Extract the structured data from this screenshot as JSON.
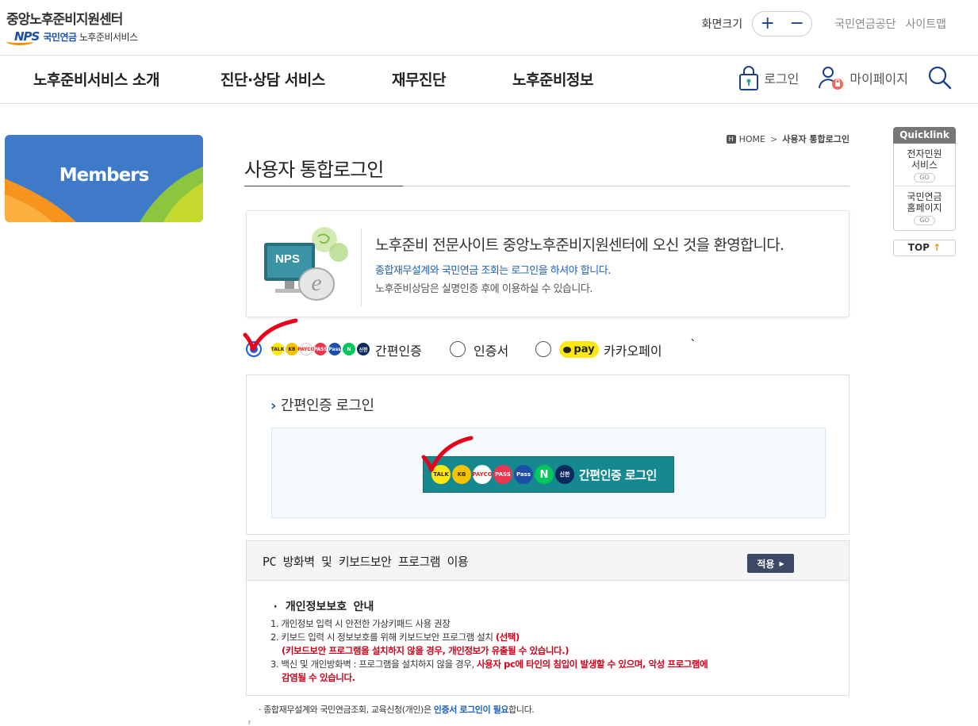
{
  "header": {
    "logo_title": "중앙노후준비지원센터",
    "logo_mark": "NPS",
    "logo_org": "국민연금",
    "logo_service": "노후준비서비스",
    "size_label": "화면크기",
    "size_plus": "+",
    "size_minus": "−",
    "links": [
      "국민연금공단",
      "사이트맵"
    ]
  },
  "gnb": {
    "items": [
      "노후준비서비스 소개",
      "진단·상담 서비스",
      "재무진단",
      "노후준비정보"
    ],
    "login": "로그인",
    "mypage": "마이페이지"
  },
  "side": {
    "banner": "Members"
  },
  "quick": {
    "head": "Quicklink",
    "items": [
      {
        "line1": "전자민원",
        "line2": "서비스",
        "go": "GO"
      },
      {
        "line1": "국민연금",
        "line2": "홈페이지",
        "go": "GO"
      }
    ],
    "top_label": "TOP",
    "top_arrow": "↑"
  },
  "breadcrumb": {
    "home_icon": "H",
    "home": "HOME",
    "sep": ">",
    "current": "사용자 통합로그인"
  },
  "page_title": "사용자 통합로그인",
  "welcome": {
    "title": "노후준비 전문사이트 중앙노후준비지원센터에 오신 것을 환영합니다.",
    "note1": "종합재무설계와 국민연금 조회는 로그인을 하셔야 합니다.",
    "note2": "노후준비상담은 실명인증 후에 이용하실 수 있습니다.",
    "illustration_label": "NPS"
  },
  "login_methods": {
    "selected": "simple",
    "options": [
      {
        "id": "simple",
        "label": "간편인증"
      },
      {
        "id": "cert",
        "label": "인증서"
      },
      {
        "id": "kakaopay",
        "label": "카카오페이",
        "pill": "pay"
      }
    ],
    "stray_mark": "`",
    "mini_badges": [
      {
        "name": "kakaotalk",
        "text": "TALK",
        "color": "#ffe812"
      },
      {
        "name": "kb",
        "text": "KB",
        "color": "#f5c400"
      },
      {
        "name": "payco",
        "text": "PAYCO",
        "color": "#ffffff"
      },
      {
        "name": "pass",
        "text": "PASS",
        "color": "#e8374f"
      },
      {
        "name": "samsung-pass",
        "text": "Pass",
        "color": "#1d4ea8"
      },
      {
        "name": "naver",
        "text": "N",
        "color": "#03c75a"
      },
      {
        "name": "shinhan",
        "text": "신한",
        "color": "#0a2a5e"
      }
    ]
  },
  "simple_login": {
    "title": "간편인증 로그인",
    "chevron": "›",
    "button_label": "간편인증 로그인",
    "badges": [
      {
        "name": "kakaotalk",
        "text": "TALK",
        "color": "#ffe812",
        "fg": "#3a1d1d"
      },
      {
        "name": "kb",
        "text": "KB",
        "color": "#f5c400",
        "fg": "#3a2a00"
      },
      {
        "name": "payco",
        "text": "PAYCO",
        "color": "#ffffff",
        "fg": "#e52528"
      },
      {
        "name": "pass",
        "text": "PASS",
        "color": "#e8374f",
        "fg": "#ffffff"
      },
      {
        "name": "samsung-pass",
        "text": "Pass",
        "color": "#1d4ea8",
        "fg": "#ffffff"
      },
      {
        "name": "naver",
        "text": "N",
        "color": "#03c75a",
        "fg": "#ffffff"
      },
      {
        "name": "shinhan",
        "text": "신한",
        "color": "#0a2a5e",
        "fg": "#ffffff"
      }
    ]
  },
  "security": {
    "title": "PC 방화벽 및 키보드보안 프로그램 이용",
    "apply": "적용",
    "apply_arrow": "▶",
    "privacy_title": "· 개인정보보호 안내",
    "items": {
      "i1": "1. 개인정보 입력 시 안전한 가상키패드 사용 권장",
      "i2": "2. 키보드 입력 시 정보보호를 위해 키보드보안 프로그램 설치",
      "i2_red": "(선택)",
      "i2_warn": "(키보드보안 프로그램을 설치하지 않을 경우, 개인정보가 유출될 수 있습니다.)",
      "i3": "3. 백신 및 개인방화벽 : 프로그램을 설치하지 않을 경우,",
      "i3_red": "사용자 pc에 타인의 침입이 발생할 수 있으며, 악성 프로그램에",
      "i3_red2": "감염될 수 있습니다."
    }
  },
  "footnote": {
    "prefix": "· 종합재무설계와 국민연금조회, 교육신청(개인)은",
    "bold": "인증서 로그인이 필요",
    "suffix": "합니다."
  },
  "tiny_mark": "r",
  "colors": {
    "brand_blue": "#1c4fa3",
    "accent_orange": "#f39200",
    "teal_button": "#168890",
    "check_red": "#e8001c"
  }
}
